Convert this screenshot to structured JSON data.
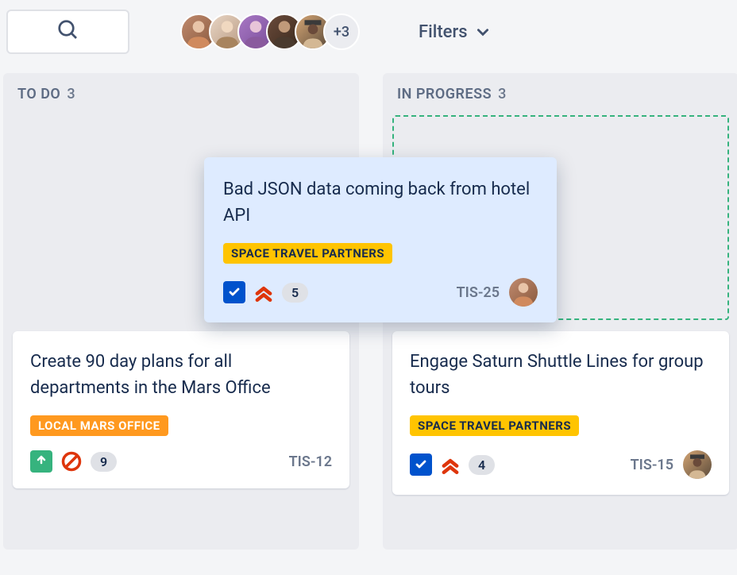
{
  "toolbar": {
    "filters_label": "Filters",
    "more_avatars": "+3"
  },
  "columns": [
    {
      "title": "TO DO",
      "count": "3"
    },
    {
      "title": "IN PROGRESS",
      "count": "3"
    }
  ],
  "dragging_card": {
    "title": "Bad JSON data coming back from hotel API",
    "label": "SPACE TRAVEL PARTNERS",
    "label_color": "yellow",
    "type": "task",
    "priority": "highest",
    "points": "5",
    "key": "TIS-25"
  },
  "cards": {
    "todo": {
      "title": "Create 90 day plans for all departments in the Mars Office",
      "label": "LOCAL MARS OFFICE",
      "label_color": "orange",
      "type": "story",
      "flagged": true,
      "points": "9",
      "key": "TIS-12"
    },
    "inprogress": {
      "title": "Engage Saturn Shuttle Lines for group tours",
      "label": "SPACE TRAVEL PARTNERS",
      "label_color": "yellow",
      "type": "task",
      "priority": "highest",
      "points": "4",
      "key": "TIS-15"
    }
  }
}
